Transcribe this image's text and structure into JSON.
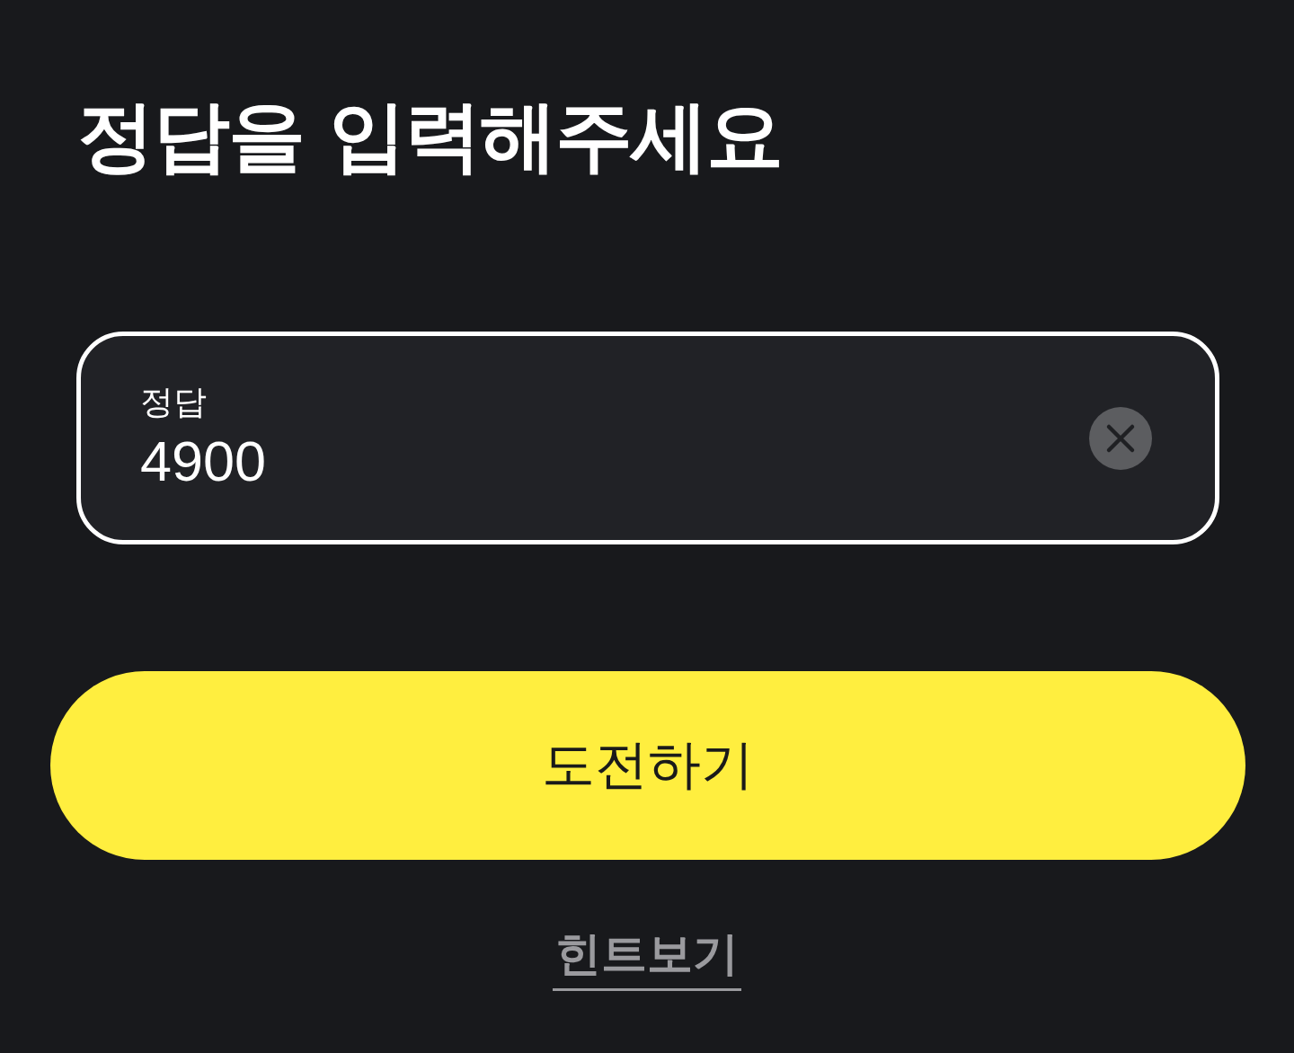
{
  "heading": "정답을 입력해주세요",
  "answer_field": {
    "label": "정답",
    "value": "4900",
    "focused": true
  },
  "submit_button": {
    "label": "도전하기"
  },
  "hint_link": {
    "label": "힌트보기"
  }
}
